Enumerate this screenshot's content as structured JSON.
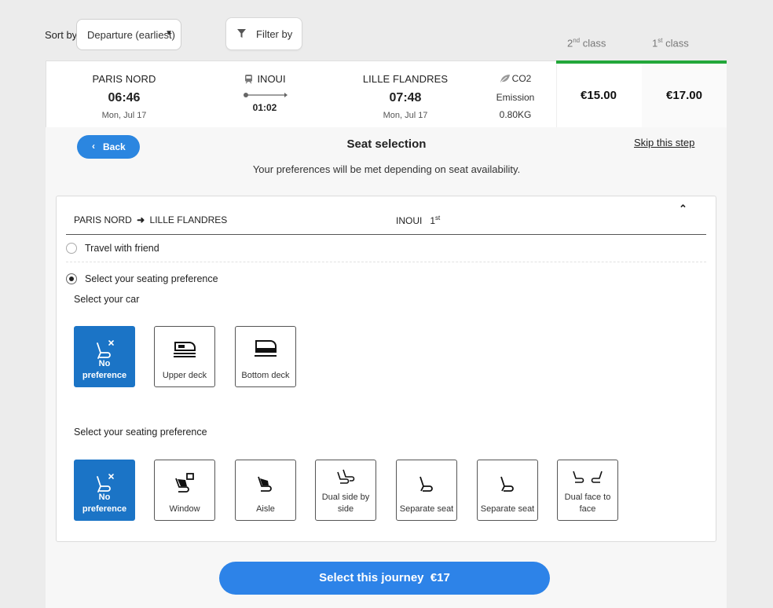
{
  "toolbar": {
    "sort_label": "Sort by",
    "sort_value": "Departure (earliest)",
    "filter_label": "Filter by"
  },
  "classes": {
    "second": {
      "num": "2",
      "sup": "nd",
      "word": " class"
    },
    "first": {
      "num": "1",
      "sup": "st",
      "word": " class"
    }
  },
  "journey": {
    "origin": {
      "name": "PARIS NORD",
      "time": "06:46",
      "date": "Mon, Jul 17"
    },
    "train": {
      "name": "INOUI",
      "duration": "01:02"
    },
    "destination": {
      "name": "LILLE FLANDRES",
      "time": "07:48",
      "date": "Mon, Jul 17"
    },
    "co2": {
      "label": "CO2",
      "sub": "Emission",
      "value": "0.80KG"
    },
    "price_second": "€15.00",
    "price_first": "€17.00",
    "accent_color": "#22a73a"
  },
  "seat_selection": {
    "back_label": "Back",
    "title": "Seat selection",
    "skip_label": "Skip this step",
    "note": "Your preferences will be met depending on seat availability.",
    "route_from": "PARIS NORD",
    "route_to": "LILLE FLANDRES",
    "train": "INOUI",
    "class_num": "1",
    "class_sup": "st",
    "option_friend": "Travel with friend",
    "option_pref": "Select your seating preference",
    "car_heading": "Select your car",
    "car_options": [
      {
        "label": "No preference",
        "icon": "seat-no-preference-icon",
        "selected": true
      },
      {
        "label": "Upper deck",
        "icon": "upper-deck-train-icon",
        "selected": false
      },
      {
        "label": "Bottom deck",
        "icon": "bottom-deck-train-icon",
        "selected": false
      }
    ],
    "seat_heading": "Select your seating preference",
    "seat_options": [
      {
        "label": "No preference",
        "icon": "seat-no-preference-icon",
        "selected": true
      },
      {
        "label": "Window",
        "icon": "window-seat-icon",
        "selected": false
      },
      {
        "label": "Aisle",
        "icon": "aisle-seat-icon",
        "selected": false
      },
      {
        "label": "Dual side by side",
        "icon": "dual-side-by-side-seat-icon",
        "selected": false
      },
      {
        "label": "Separate seat",
        "icon": "separate-seat-icon",
        "selected": false
      },
      {
        "label": "Separate seat",
        "icon": "separate-seat-icon",
        "selected": false
      },
      {
        "label": "Dual face to face",
        "icon": "dual-face-to-face-seat-icon",
        "selected": false
      }
    ],
    "cta_label": "Select this journey",
    "cta_price": "€17",
    "primary_color": "#2d83e8",
    "selected_tile_color": "#1b74c6"
  }
}
